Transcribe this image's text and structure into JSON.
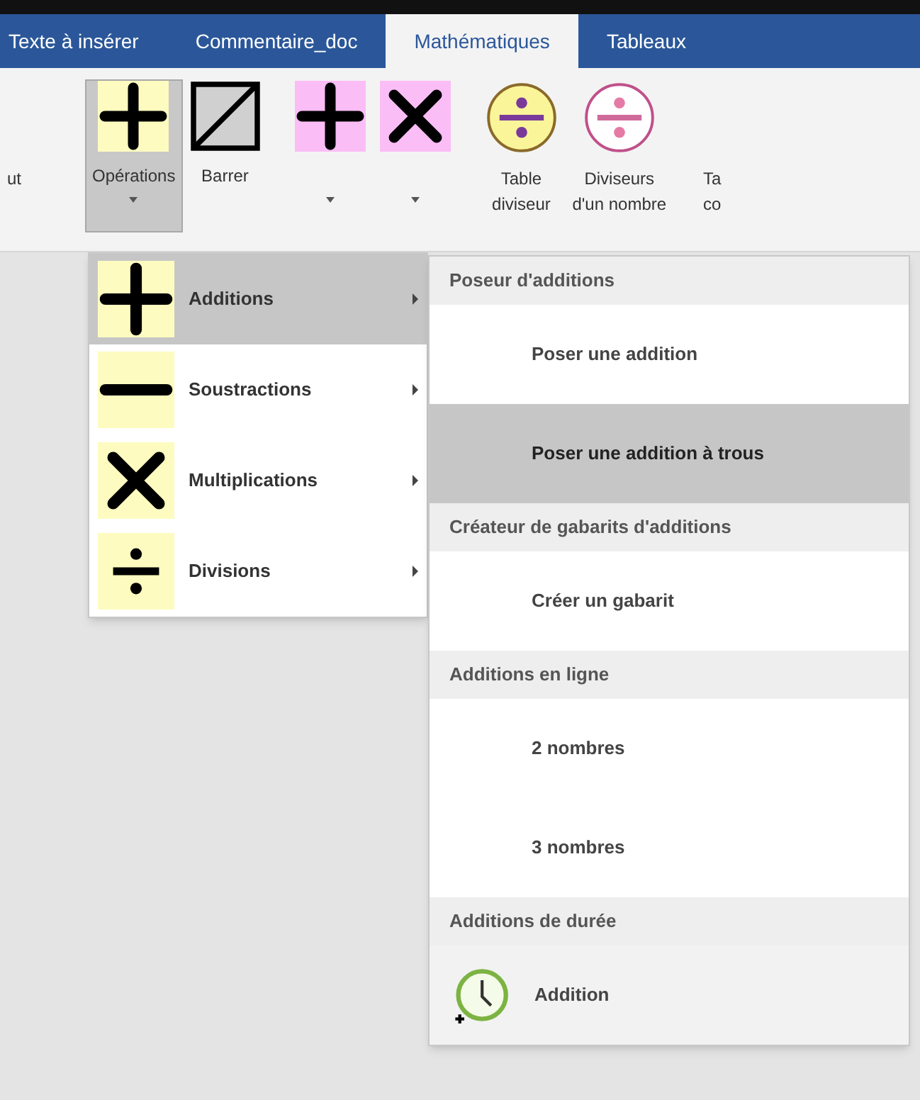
{
  "tabs": [
    {
      "label": "Texte à insérer",
      "selected": false
    },
    {
      "label": "Commentaire_doc",
      "selected": false
    },
    {
      "label": "Mathématiques",
      "selected": true
    },
    {
      "label": "Tableaux",
      "selected": false
    }
  ],
  "ribbon": [
    {
      "kind": "cut",
      "lines": [
        "ut"
      ],
      "selected": false,
      "dropdown": false
    },
    {
      "kind": "plus-yellow",
      "lines": [
        "Opérations"
      ],
      "selected": true,
      "dropdown": true
    },
    {
      "kind": "strike",
      "lines": [
        "Barrer"
      ],
      "selected": false,
      "dropdown": false
    },
    {
      "kind": "plus-pink",
      "selected": false,
      "dropdown": true
    },
    {
      "kind": "times-pink",
      "selected": false,
      "dropdown": true
    },
    {
      "kind": "divide-yellow",
      "lines": [
        "Table",
        "diviseur"
      ],
      "selected": false,
      "dropdown": false
    },
    {
      "kind": "divide-pink",
      "lines": [
        "Diviseurs",
        "d'un nombre"
      ],
      "selected": false,
      "dropdown": false
    },
    {
      "kind": "cut",
      "lines": [
        "Ta",
        "co"
      ],
      "selected": false,
      "dropdown": false
    }
  ],
  "menu": [
    {
      "kind": "plus",
      "label": "Additions",
      "selected": true
    },
    {
      "kind": "minus",
      "label": "Soustractions",
      "selected": false
    },
    {
      "kind": "times",
      "label": "Multiplications",
      "selected": false
    },
    {
      "kind": "divide",
      "label": "Divisions",
      "selected": false
    }
  ],
  "submenu": [
    {
      "kind": "header",
      "label": "Poseur d'additions"
    },
    {
      "kind": "item",
      "label": "Poser une addition",
      "selected": false
    },
    {
      "kind": "item",
      "label": "Poser une addition à trous",
      "selected": true
    },
    {
      "kind": "header",
      "label": "Créateur de gabarits d'additions"
    },
    {
      "kind": "item",
      "label": "Créer un gabarit",
      "selected": false
    },
    {
      "kind": "header",
      "label": "Additions en ligne"
    },
    {
      "kind": "item",
      "label": "2 nombres",
      "selected": false
    },
    {
      "kind": "item",
      "label": "3 nombres",
      "selected": false
    },
    {
      "kind": "header",
      "label": "Additions de durée"
    },
    {
      "kind": "clock",
      "label": "Addition",
      "selected": false
    }
  ]
}
